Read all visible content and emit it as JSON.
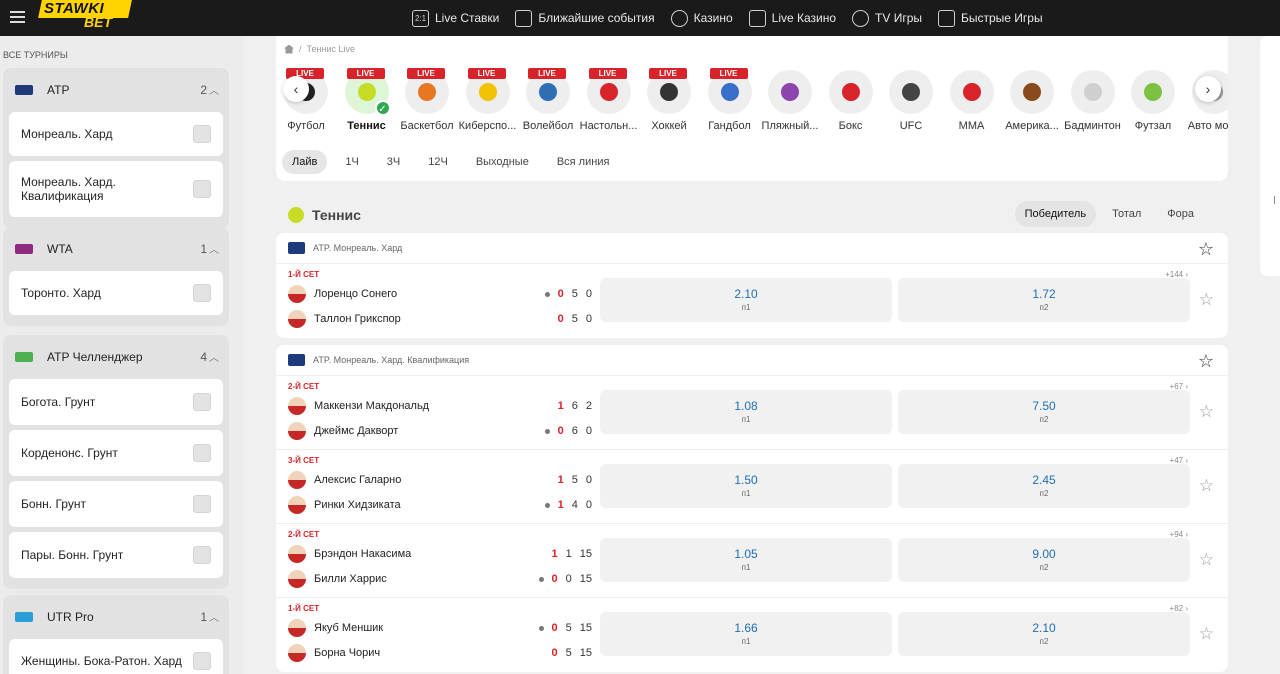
{
  "topnav": {
    "items": [
      {
        "label": "Live Ставки",
        "icon": "live-icon"
      },
      {
        "label": "Ближайшие события",
        "icon": "calendar-icon"
      },
      {
        "label": "Казино",
        "icon": "casino-chip-icon"
      },
      {
        "label": "Live Казино",
        "icon": "cards-icon"
      },
      {
        "label": "TV Игры",
        "icon": "tv-icon"
      },
      {
        "label": "Быстрые Игры",
        "icon": "rocket-icon"
      }
    ],
    "live_icon_text": "2:1"
  },
  "logo": {
    "part1": "STAWKI",
    "part2": "BET"
  },
  "sidebar": {
    "all_label": "ВСЕ ТУРНИРЫ",
    "groups": [
      {
        "name": "ATP",
        "count": "2",
        "flag_color": "#1f3a7a",
        "items": [
          "Монреаль. Хард",
          "Монреаль. Хард. Квалификация"
        ]
      },
      {
        "name": "WTA",
        "count": "1",
        "flag_color": "#8e2a7e",
        "items": [
          "Торонто. Хард"
        ]
      },
      {
        "name": "ATP Челленджер",
        "count": "4",
        "flag_color": "#4caf50",
        "items": [
          "Богота. Грунт",
          "Корденонс. Грунт",
          "Бонн. Грунт",
          "Пары. Бонн. Грунт"
        ]
      },
      {
        "name": "UTR Pro",
        "count": "1",
        "flag_color": "#2a9fd6",
        "items": [
          "Женщины. Бока-Ратон. Хард"
        ]
      }
    ]
  },
  "breadcrumb": {
    "current": "Теннис Live"
  },
  "sports": [
    {
      "label": "Футбол",
      "live": true,
      "color": "#222"
    },
    {
      "label": "Теннис",
      "live": true,
      "color": "#c7dc26",
      "active": true
    },
    {
      "label": "Баскетбол",
      "live": true,
      "color": "#e87722"
    },
    {
      "label": "Киберспо...",
      "live": true,
      "color": "#f2c200"
    },
    {
      "label": "Волейбол",
      "live": true,
      "color": "#2f6db5"
    },
    {
      "label": "Настольн...",
      "live": true,
      "color": "#d8232a"
    },
    {
      "label": "Хоккей",
      "live": true,
      "color": "#333"
    },
    {
      "label": "Гандбол",
      "live": true,
      "color": "#3a6fc9"
    },
    {
      "label": "Пляжный...",
      "live": false,
      "color": "#8e44ad"
    },
    {
      "label": "Бокс",
      "live": false,
      "color": "#d8232a"
    },
    {
      "label": "UFC",
      "live": false,
      "color": "#444"
    },
    {
      "label": "MMA",
      "live": false,
      "color": "#d8232a"
    },
    {
      "label": "Америка...",
      "live": false,
      "color": "#8b4a1c"
    },
    {
      "label": "Бадминтон",
      "live": false,
      "color": "#cfcfcf"
    },
    {
      "label": "Футзал",
      "live": false,
      "color": "#7cc142"
    },
    {
      "label": "Авто мото",
      "live": false,
      "color": "#999"
    }
  ],
  "sport_nav": {
    "prev": "‹",
    "next": "›"
  },
  "time_filters": [
    "Лайв",
    "1Ч",
    "3Ч",
    "12Ч",
    "Выходные",
    "Вся линия"
  ],
  "section": {
    "title": "Теннис",
    "tabs": [
      "Победитель",
      "Тотал",
      "Фора"
    ]
  },
  "odds_labels": {
    "p1": "п1",
    "p2": "п2"
  },
  "leagues": [
    {
      "name": "ATP. Монреаль. Хард",
      "matches": [
        {
          "set": "1-й сет",
          "more": "+144 ›",
          "p1": {
            "name": "Лоренцо Сонего",
            "serve": true,
            "scores": [
              "0",
              "5",
              "0"
            ]
          },
          "p2": {
            "name": "Таллон Грикспор",
            "serve": false,
            "scores": [
              "0",
              "5",
              "0"
            ]
          },
          "odd1": "2.10",
          "odd2": "1.72"
        }
      ]
    },
    {
      "name": "ATP. Монреаль. Хард. Квалификация",
      "matches": [
        {
          "set": "2-й сет",
          "more": "+67 ›",
          "p1": {
            "name": "Маккензи Макдональд",
            "serve": false,
            "scores": [
              "1",
              "6",
              "2"
            ]
          },
          "p2": {
            "name": "Джеймс Дакворт",
            "serve": true,
            "scores": [
              "0",
              "6",
              "0"
            ]
          },
          "odd1": "1.08",
          "odd2": "7.50"
        },
        {
          "set": "3-й сет",
          "more": "+47 ›",
          "p1": {
            "name": "Алексис Галарно",
            "serve": false,
            "scores": [
              "1",
              "5",
              "0"
            ]
          },
          "p2": {
            "name": "Ринки Хидзиката",
            "serve": true,
            "scores": [
              "1",
              "4",
              "0"
            ]
          },
          "odd1": "1.50",
          "odd2": "2.45"
        },
        {
          "set": "2-й сет",
          "more": "+94 ›",
          "p1": {
            "name": "Брэндон Накасима",
            "serve": false,
            "scores": [
              "1",
              "1",
              "15"
            ]
          },
          "p2": {
            "name": "Билли Харрис",
            "serve": true,
            "scores": [
              "0",
              "0",
              "15"
            ]
          },
          "odd1": "1.05",
          "odd2": "9.00"
        },
        {
          "set": "1-й сет",
          "more": "+82 ›",
          "p1": {
            "name": "Якуб Меншик",
            "serve": true,
            "scores": [
              "0",
              "5",
              "15"
            ]
          },
          "p2": {
            "name": "Борна Чорич",
            "serve": false,
            "scores": [
              "0",
              "5",
              "15"
            ]
          },
          "odd1": "1.66",
          "odd2": "2.10"
        }
      ]
    }
  ],
  "colors": {
    "brand": "#ffd400",
    "live": "#d8232a",
    "odds": "#1f6fb2",
    "topbar": "#1a1a1a"
  }
}
